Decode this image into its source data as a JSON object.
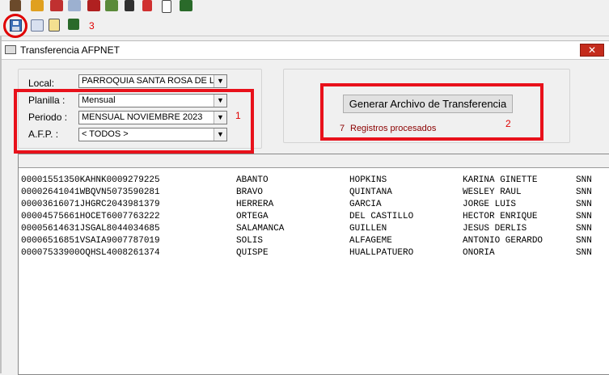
{
  "window": {
    "title": "Transferencia AFPNET",
    "close_label": "✕"
  },
  "toolbar": {
    "top_icons": [
      "person-icon",
      "box-icon",
      "mail-icon",
      "table-icon",
      "help-icon",
      "books-icon",
      "run-icon",
      "lightning-icon",
      "document-icon",
      "exit-icon"
    ],
    "second_icons": [
      "save-icon",
      "print-icon",
      "preview-icon",
      "exit-icon"
    ],
    "annotation_3": "3"
  },
  "form": {
    "local_label": "Local:",
    "local_value": "PARROQUIA SANTA ROSA DE LIMA",
    "planilla_label": "Planilla :",
    "planilla_value": "Mensual",
    "periodo_label": "Periodo :",
    "periodo_value": "MENSUAL NOVIEMBRE 2023",
    "afp_label": "A.F.P. :",
    "afp_value": "< TODOS >",
    "annotation_1": "1"
  },
  "action": {
    "generate_label": "Generar Archivo de Transferencia",
    "status_count": "7",
    "status_text": "Registros procesados",
    "annotation_2": "2"
  },
  "rows": [
    {
      "code": "00001551350KAHNK0009279225",
      "apellido1": "ABANTO",
      "apellido2": "HOPKINS",
      "nombres": "KARINA GINETTE",
      "extra": "SNN"
    },
    {
      "code": "00002641041WBQVN5073590281",
      "apellido1": "BRAVO",
      "apellido2": "QUINTANA",
      "nombres": "WESLEY RAUL",
      "extra": "SNN"
    },
    {
      "code": "00003616071JHGRC2043981379",
      "apellido1": "HERRERA",
      "apellido2": "GARCIA",
      "nombres": "JORGE LUIS",
      "extra": "SNN"
    },
    {
      "code": "00004575661HOCET6007763222",
      "apellido1": "ORTEGA",
      "apellido2": "DEL CASTILLO",
      "nombres": "HECTOR ENRIQUE",
      "extra": "SNN"
    },
    {
      "code": "00005614631JSGAL8044034685",
      "apellido1": "SALAMANCA",
      "apellido2": "GUILLEN",
      "nombres": "JESUS  DERLIS",
      "extra": "SNN"
    },
    {
      "code": "00006516851VSAIA9007787019",
      "apellido1": "SOLIS",
      "apellido2": "ALFAGEME",
      "nombres": "ANTONIO GERARDO",
      "extra": "SNN"
    },
    {
      "code": "00007533900OQHSL4008261374",
      "apellido1": "QUISPE",
      "apellido2": "HUALLPATUERO",
      "nombres": "ONORIA",
      "extra": "SNN"
    }
  ],
  "colors": {
    "annotation_red": "#e8111b",
    "status_red": "#8b0000"
  }
}
